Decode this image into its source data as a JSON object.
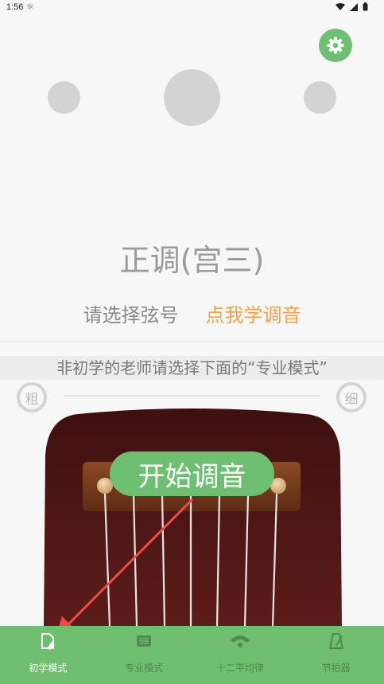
{
  "status": {
    "time": "1:56",
    "weather": "☼"
  },
  "header": {
    "settings_icon": "gear-icon"
  },
  "tuner": {
    "tuning_name": "正调(宫三)",
    "select_string_label": "请选择弦号",
    "learn_tuning_link": "点我学调音",
    "notice": "非初学的老师请选择下面的“专业模式”",
    "coarse_label": "粗",
    "fine_label": "细",
    "start_button": "开始调音"
  },
  "colors": {
    "accent": "#6fbf73",
    "link": "#f4a24a",
    "body": "#4a1414"
  },
  "bottom_nav": [
    {
      "label": "初学模式",
      "icon": "beginner-icon",
      "active": true
    },
    {
      "label": "专业模式",
      "icon": "professional-icon",
      "active": false
    },
    {
      "label": "十二平均律",
      "icon": "equal-temperament-icon",
      "active": false
    },
    {
      "label": "节拍器",
      "icon": "metronome-icon",
      "active": false
    }
  ]
}
